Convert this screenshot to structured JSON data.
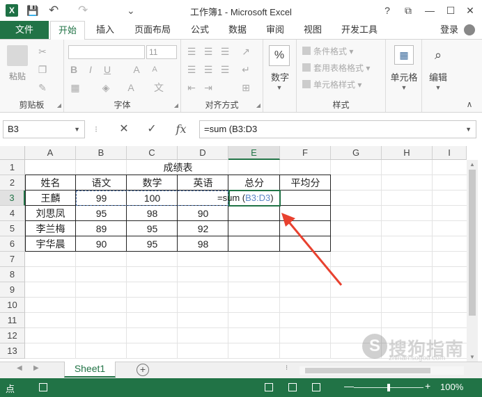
{
  "window": {
    "title": "工作簿1 - Microsoft Excel",
    "help": "?",
    "restore": "⧉",
    "minimize": "—",
    "maximize": "☐",
    "close": "✕",
    "app_icon": "X"
  },
  "quick_access": {
    "save": "💾",
    "undo": "↶",
    "redo": "↷",
    "customize": "⌄"
  },
  "tabs": [
    "文件",
    "开始",
    "插入",
    "页面布局",
    "公式",
    "数据",
    "审阅",
    "视图",
    "开发工具"
  ],
  "active_tab": "开始",
  "login": "登录",
  "ribbon": {
    "clipboard": {
      "label": "剪贴板",
      "paste": "粘贴"
    },
    "font": {
      "label": "字体",
      "size": "11",
      "bold": "B",
      "italic": "I",
      "underline": "U",
      "grow": "A",
      "shrink": "A",
      "color_a": "A",
      "phonetic": "文"
    },
    "alignment": {
      "label": "对齐方式"
    },
    "number": {
      "label": "数字",
      "pct": "%"
    },
    "styles": {
      "label": "样式",
      "conditional": "条件格式",
      "table": "套用表格格式",
      "cell_styles": "单元格样式"
    },
    "cells": {
      "label": "单元格"
    },
    "editing": {
      "label": "编辑"
    }
  },
  "formula_bar": {
    "name_box": "B3",
    "cancel": "✕",
    "enter": "✓",
    "fx": "fx",
    "formula": "=sum (B3:D3"
  },
  "columns": [
    "A",
    "B",
    "C",
    "D",
    "E",
    "F",
    "G",
    "H",
    "I"
  ],
  "selected_column": "E",
  "rows": [
    "1",
    "2",
    "3",
    "4",
    "5",
    "6",
    "7",
    "8",
    "9",
    "10",
    "11",
    "12",
    "13"
  ],
  "selected_row": "3",
  "table": {
    "title": "成绩表",
    "headers": [
      "姓名",
      "语文",
      "数学",
      "英语",
      "总分",
      "平均分"
    ],
    "data": [
      [
        "王麟",
        "99",
        "100",
        "",
        "",
        ""
      ],
      [
        "刘思凤",
        "95",
        "98",
        "90",
        "",
        ""
      ],
      [
        "李兰梅",
        "89",
        "95",
        "92",
        "",
        ""
      ],
      [
        "宇华晨",
        "90",
        "95",
        "98",
        "",
        ""
      ]
    ]
  },
  "editing_formula": {
    "prefix": "=sum (",
    "ref": "B3:D3",
    "suffix": ")"
  },
  "sheets": [
    "Sheet1"
  ],
  "add_sheet": "+",
  "status": {
    "mode": "点",
    "zoom": "100%",
    "minus": "—",
    "plus": "+"
  },
  "watermark": {
    "logo": "S",
    "text": "搜狗指南",
    "url": "zhinan.sogou.com"
  },
  "colors": {
    "excel_green": "#217346",
    "ref_blue": "#5b86c5",
    "arrow_red": "#e8412f"
  }
}
